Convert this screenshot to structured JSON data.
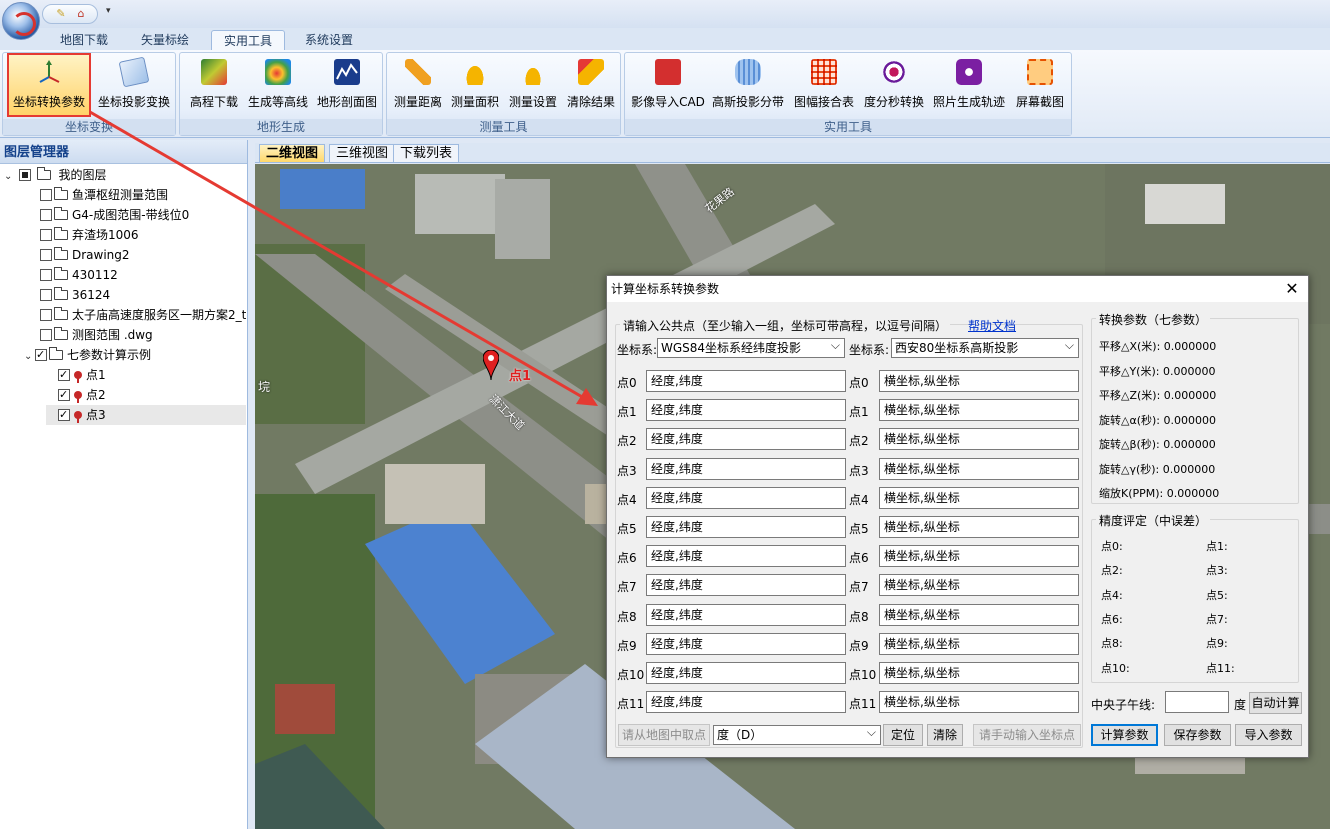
{
  "menu_tabs": [
    "地图下载",
    "矢量标绘",
    "实用工具",
    "系统设置"
  ],
  "ribbon": {
    "groups": [
      {
        "label": "坐标变换",
        "buttons": [
          "坐标转换参数",
          "坐标投影变换"
        ]
      },
      {
        "label": "地形生成",
        "buttons": [
          "高程下载",
          "生成等高线",
          "地形剖面图"
        ]
      },
      {
        "label": "测量工具",
        "buttons": [
          "测量距离",
          "测量面积",
          "测量设置",
          "清除结果"
        ]
      },
      {
        "label": "实用工具",
        "buttons": [
          "影像导入CAD",
          "高斯投影分带",
          "图幅接合表",
          "度分秒转换",
          "照片生成轨迹",
          "屏幕截图"
        ]
      }
    ]
  },
  "layer_panel": {
    "title": "图层管理器",
    "root": "我的图层",
    "layers": [
      "鱼潭枢纽测量范围",
      "G4-成图范围-带线位0",
      "弃渣场1006",
      "Drawing2",
      "430112",
      "36124",
      "太子庙高速度服务区一期方案2_t",
      "测图范围 .dwg"
    ],
    "example_group": "七参数计算示例",
    "example_points": [
      "点1",
      "点2",
      "点3"
    ]
  },
  "view_tabs": [
    "二维视图",
    "三维视图",
    "下载列表"
  ],
  "map_labels": {
    "road1": "花果路",
    "road2": "潇江大道",
    "marker": "点1",
    "edge": "垸"
  },
  "dialog": {
    "title": "计算坐标系转换参数",
    "close": "✕",
    "instruction": "请输入公共点（至少输入一组，坐标可带高程，以逗号间隔）",
    "help_link": "帮助文档",
    "src_label": "坐标系:",
    "src_value": "WGS84坐标系经纬度投影",
    "dst_label": "坐标系:",
    "dst_value": "西安80坐标系高斯投影",
    "point_labels": [
      "点0",
      "点1",
      "点2",
      "点3",
      "点4",
      "点5",
      "点6",
      "点7",
      "点8",
      "点9",
      "点10",
      "点11"
    ],
    "src_placeholder": "经度,纬度",
    "dst_placeholder": "横坐标,纵坐标",
    "btn_pick": "请从地图中取点",
    "unit_value": "度（D）",
    "btn_locate": "定位",
    "btn_clear": "清除",
    "btn_manual": "请手动输入坐标点",
    "params_title": "转换参数（七参数）",
    "params": [
      {
        "label": "平移△X(米):",
        "value": "0.000000"
      },
      {
        "label": "平移△Y(米):",
        "value": "0.000000"
      },
      {
        "label": "平移△Z(米):",
        "value": "0.000000"
      },
      {
        "label": "旋转△α(秒):",
        "value": "0.000000"
      },
      {
        "label": "旋转△β(秒):",
        "value": "0.000000"
      },
      {
        "label": "旋转△γ(秒):",
        "value": "0.000000"
      },
      {
        "label": "缩放K(PPM):",
        "value": "0.000000"
      }
    ],
    "accuracy_title": "精度评定（中误差）",
    "accuracy_left": [
      "点0:",
      "点2:",
      "点4:",
      "点6:",
      "点8:",
      "点10:"
    ],
    "accuracy_right": [
      "点1:",
      "点3:",
      "点5:",
      "点7:",
      "点9:",
      "点11:"
    ],
    "meridian_label": "中央子午线:",
    "meridian_unit": "度",
    "btn_auto": "自动计算",
    "btn_calc": "计算参数",
    "btn_save": "保存参数",
    "btn_import": "导入参数"
  },
  "colors": {
    "highlight_border": "#e53a32",
    "arrow": "#e53a32",
    "ribbon_text": "#1e395b",
    "link": "#0033cc"
  }
}
